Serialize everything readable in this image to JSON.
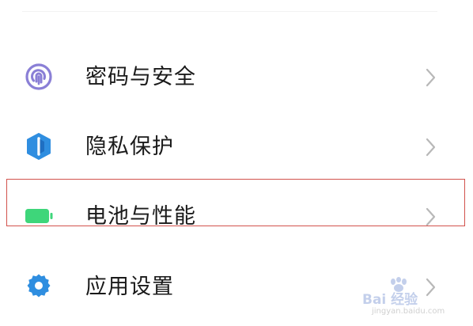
{
  "settings": {
    "items": [
      {
        "label": "密码与安全",
        "icon": "fingerprint-icon",
        "icon_color": "#8a7fd6"
      },
      {
        "label": "隐私保护",
        "icon": "privacy-shield-icon",
        "icon_color": "#2f8ee0"
      },
      {
        "label": "电池与性能",
        "icon": "battery-icon",
        "icon_color": "#3ed67a"
      },
      {
        "label": "应用设置",
        "icon": "gear-icon",
        "icon_color": "#2f8ee0"
      }
    ],
    "chevron_color": "#b8b8b8",
    "highlight_color": "#d2524c"
  },
  "watermark": {
    "brand": "Bai 经验",
    "site": "jingyan.baidu.com"
  }
}
